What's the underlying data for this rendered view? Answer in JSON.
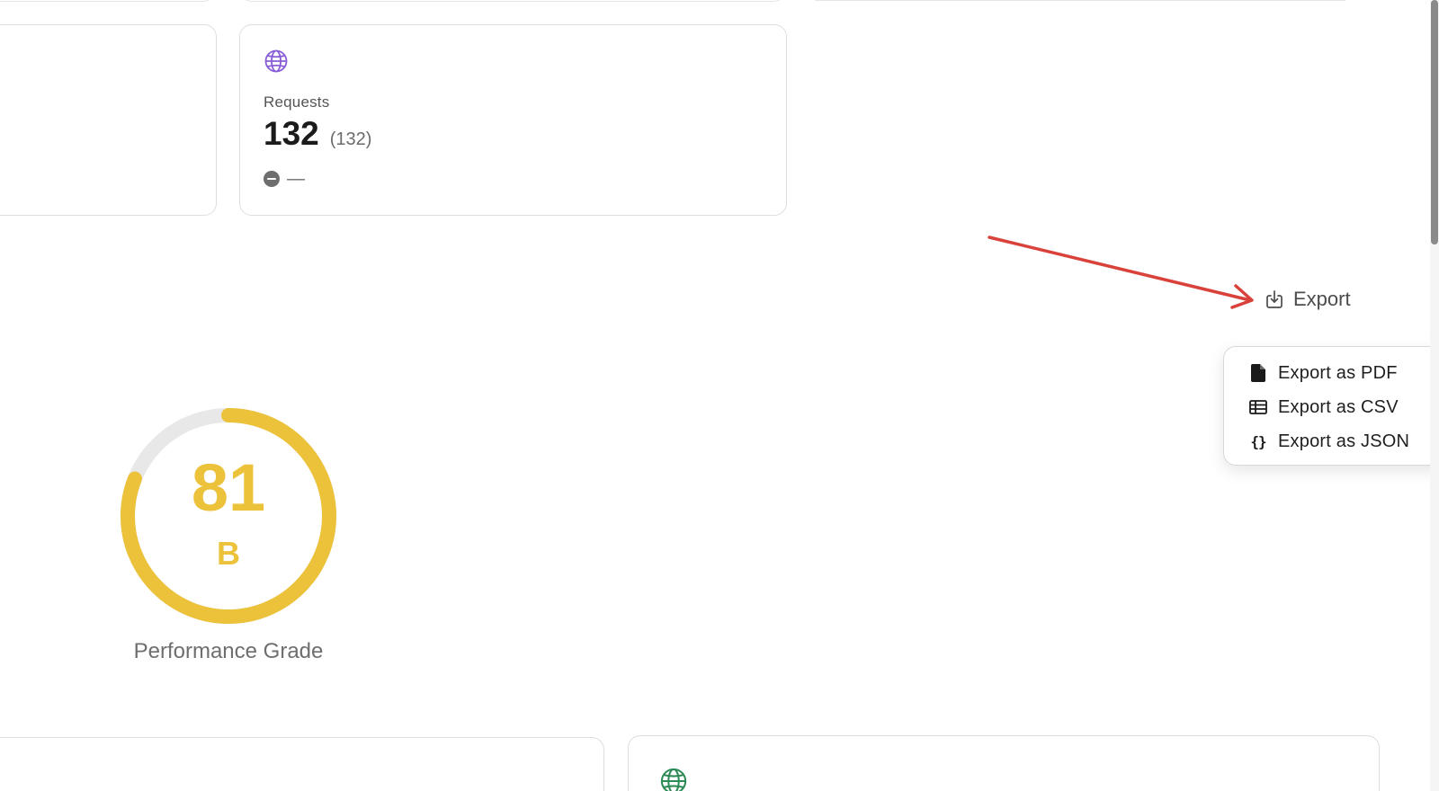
{
  "requests_card": {
    "label": "Requests",
    "value": "132",
    "sub_value": "(132)",
    "change": "—",
    "icon": "globe-icon",
    "icon_color": "#8a5cd6"
  },
  "export": {
    "button_label": "Export",
    "button_icon": "download-icon",
    "menu": [
      {
        "label": "Export as PDF",
        "icon": "file-icon"
      },
      {
        "label": "Export as CSV",
        "icon": "table-icon"
      },
      {
        "label": "Export as JSON",
        "icon": "braces-icon"
      }
    ]
  },
  "performance": {
    "score": "81",
    "grade": "B",
    "caption": "Performance Grade",
    "score_fraction": 0.81,
    "color": "#ecc23b",
    "track_color": "#e8e8e8"
  },
  "bottom_card": {
    "icon": "globe-icon",
    "icon_color": "#2e8a57"
  },
  "annotation": {
    "arrow_color": "#d9423b"
  }
}
